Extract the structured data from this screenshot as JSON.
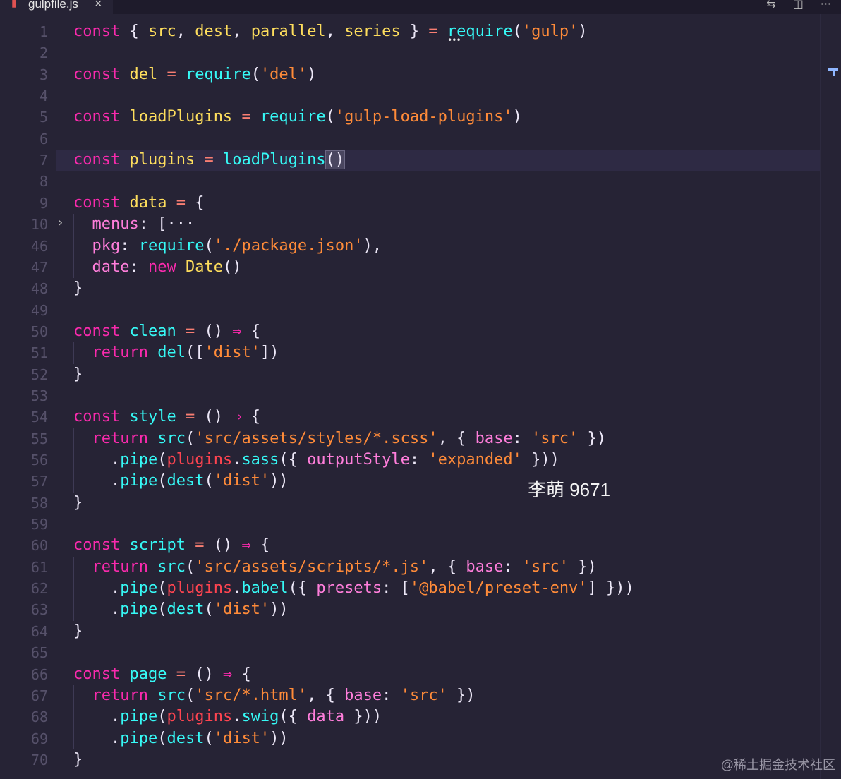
{
  "tab": {
    "filename": "gulpfile.js",
    "close": "×",
    "file_icon": "▮"
  },
  "actions": [
    "⇆",
    "◫",
    "···"
  ],
  "code": {
    "line_numbers": [
      "1",
      "2",
      "3",
      "4",
      "5",
      "6",
      "7",
      "8",
      "9",
      "10",
      "46",
      "47",
      "48",
      "49",
      "50",
      "51",
      "52",
      "53",
      "54",
      "55",
      "56",
      "57",
      "58",
      "59",
      "60",
      "61",
      "62",
      "63",
      "64",
      "65",
      "66",
      "67",
      "68",
      "69",
      "70"
    ],
    "lines": [
      [
        [
          "const ",
          "t-const"
        ],
        [
          "{ ",
          "t-pun"
        ],
        [
          "src",
          "t-name"
        ],
        [
          ", ",
          "t-pun"
        ],
        [
          "dest",
          "t-name"
        ],
        [
          ", ",
          "t-pun"
        ],
        [
          "parallel",
          "t-name"
        ],
        [
          ", ",
          "t-pun"
        ],
        [
          "series",
          "t-name"
        ],
        [
          " } ",
          "t-pun"
        ],
        [
          "= ",
          "t-op"
        ],
        [
          "require",
          "t-fn"
        ],
        [
          "(",
          "t-pun"
        ],
        [
          "'gulp'",
          "t-str"
        ],
        [
          ")",
          "t-pun"
        ]
      ],
      [],
      [
        [
          "const ",
          "t-const"
        ],
        [
          "del ",
          "t-name"
        ],
        [
          "= ",
          "t-op"
        ],
        [
          "require",
          "t-fn"
        ],
        [
          "(",
          "t-pun"
        ],
        [
          "'del'",
          "t-str"
        ],
        [
          ")",
          "t-pun"
        ]
      ],
      [],
      [
        [
          "const ",
          "t-const"
        ],
        [
          "loadPlugins ",
          "t-name"
        ],
        [
          "= ",
          "t-op"
        ],
        [
          "require",
          "t-fn"
        ],
        [
          "(",
          "t-pun"
        ],
        [
          "'gulp-load-plugins'",
          "t-str"
        ],
        [
          ")",
          "t-pun"
        ]
      ],
      [],
      [
        [
          "const ",
          "t-const"
        ],
        [
          "plugins ",
          "t-name"
        ],
        [
          "= ",
          "t-op"
        ],
        [
          "loadPlugins",
          "t-fn"
        ],
        [
          "()",
          "t-pun paren-hl"
        ]
      ],
      [],
      [
        [
          "const ",
          "t-const"
        ],
        [
          "data ",
          "t-name"
        ],
        [
          "= ",
          "t-op"
        ],
        [
          "{",
          "t-pun"
        ]
      ],
      [
        [
          "  ",
          " "
        ],
        [
          "menus",
          "t-prop"
        ],
        [
          ": ",
          "t-pun"
        ],
        [
          "[",
          "t-pun"
        ],
        [
          "···",
          "t-pun"
        ]
      ],
      [
        [
          "  ",
          " "
        ],
        [
          "pkg",
          "t-prop"
        ],
        [
          ": ",
          "t-pun"
        ],
        [
          "require",
          "t-fn"
        ],
        [
          "(",
          "t-pun"
        ],
        [
          "'./package.json'",
          "t-str"
        ],
        [
          "),",
          "t-pun"
        ]
      ],
      [
        [
          "  ",
          " "
        ],
        [
          "date",
          "t-prop"
        ],
        [
          ": ",
          "t-pun"
        ],
        [
          "new ",
          "t-const"
        ],
        [
          "Date",
          "t-new"
        ],
        [
          "()",
          "t-pun"
        ]
      ],
      [
        [
          "}",
          "t-pun"
        ]
      ],
      [],
      [
        [
          "const ",
          "t-const"
        ],
        [
          "clean ",
          "t-fn"
        ],
        [
          "= ",
          "t-op"
        ],
        [
          "() ",
          "t-pun"
        ],
        [
          "⇒ ",
          "t-const"
        ],
        [
          "{",
          "t-pun"
        ]
      ],
      [
        [
          "  ",
          " "
        ],
        [
          "return ",
          "t-const"
        ],
        [
          "del",
          "t-fn"
        ],
        [
          "([",
          "t-pun"
        ],
        [
          "'dist'",
          "t-str"
        ],
        [
          "])",
          "t-pun"
        ]
      ],
      [
        [
          "}",
          "t-pun"
        ]
      ],
      [],
      [
        [
          "const ",
          "t-const"
        ],
        [
          "style ",
          "t-fn"
        ],
        [
          "= ",
          "t-op"
        ],
        [
          "() ",
          "t-pun"
        ],
        [
          "⇒ ",
          "t-const"
        ],
        [
          "{",
          "t-pun"
        ]
      ],
      [
        [
          "  ",
          " "
        ],
        [
          "return ",
          "t-const"
        ],
        [
          "src",
          "t-fn"
        ],
        [
          "(",
          "t-pun"
        ],
        [
          "'src/assets/styles/*.scss'",
          "t-str"
        ],
        [
          ", { ",
          "t-pun"
        ],
        [
          "base",
          "t-prop"
        ],
        [
          ": ",
          "t-pun"
        ],
        [
          "'src'",
          "t-str"
        ],
        [
          " })",
          "t-pun"
        ]
      ],
      [
        [
          "    ",
          " "
        ],
        [
          ".",
          "t-pun"
        ],
        [
          "pipe",
          "t-fn"
        ],
        [
          "(",
          "t-pun"
        ],
        [
          "plugins",
          "t-cls"
        ],
        [
          ".",
          "t-pun"
        ],
        [
          "sass",
          "t-fn"
        ],
        [
          "({ ",
          "t-pun"
        ],
        [
          "outputStyle",
          "t-prop"
        ],
        [
          ": ",
          "t-pun"
        ],
        [
          "'expanded'",
          "t-str"
        ],
        [
          " }))",
          "t-pun"
        ]
      ],
      [
        [
          "    ",
          " "
        ],
        [
          ".",
          "t-pun"
        ],
        [
          "pipe",
          "t-fn"
        ],
        [
          "(",
          "t-pun"
        ],
        [
          "dest",
          "t-fn"
        ],
        [
          "(",
          "t-pun"
        ],
        [
          "'dist'",
          "t-str"
        ],
        [
          "))",
          "t-pun"
        ]
      ],
      [
        [
          "}",
          "t-pun"
        ]
      ],
      [],
      [
        [
          "const ",
          "t-const"
        ],
        [
          "script ",
          "t-fn"
        ],
        [
          "= ",
          "t-op"
        ],
        [
          "() ",
          "t-pun"
        ],
        [
          "⇒ ",
          "t-const"
        ],
        [
          "{",
          "t-pun"
        ]
      ],
      [
        [
          "  ",
          " "
        ],
        [
          "return ",
          "t-const"
        ],
        [
          "src",
          "t-fn"
        ],
        [
          "(",
          "t-pun"
        ],
        [
          "'src/assets/scripts/*.js'",
          "t-str"
        ],
        [
          ", { ",
          "t-pun"
        ],
        [
          "base",
          "t-prop"
        ],
        [
          ": ",
          "t-pun"
        ],
        [
          "'src'",
          "t-str"
        ],
        [
          " })",
          "t-pun"
        ]
      ],
      [
        [
          "    ",
          " "
        ],
        [
          ".",
          "t-pun"
        ],
        [
          "pipe",
          "t-fn"
        ],
        [
          "(",
          "t-pun"
        ],
        [
          "plugins",
          "t-cls"
        ],
        [
          ".",
          "t-pun"
        ],
        [
          "babel",
          "t-fn"
        ],
        [
          "({ ",
          "t-pun"
        ],
        [
          "presets",
          "t-prop"
        ],
        [
          ": [",
          "t-pun"
        ],
        [
          "'@babel/preset-env'",
          "t-str"
        ],
        [
          "] }))",
          "t-pun"
        ]
      ],
      [
        [
          "    ",
          " "
        ],
        [
          ".",
          "t-pun"
        ],
        [
          "pipe",
          "t-fn"
        ],
        [
          "(",
          "t-pun"
        ],
        [
          "dest",
          "t-fn"
        ],
        [
          "(",
          "t-pun"
        ],
        [
          "'dist'",
          "t-str"
        ],
        [
          "))",
          "t-pun"
        ]
      ],
      [
        [
          "}",
          "t-pun"
        ]
      ],
      [],
      [
        [
          "const ",
          "t-const"
        ],
        [
          "page ",
          "t-fn"
        ],
        [
          "= ",
          "t-op"
        ],
        [
          "() ",
          "t-pun"
        ],
        [
          "⇒ ",
          "t-const"
        ],
        [
          "{",
          "t-pun"
        ]
      ],
      [
        [
          "  ",
          " "
        ],
        [
          "return ",
          "t-const"
        ],
        [
          "src",
          "t-fn"
        ],
        [
          "(",
          "t-pun"
        ],
        [
          "'src/*.html'",
          "t-str"
        ],
        [
          ", { ",
          "t-pun"
        ],
        [
          "base",
          "t-prop"
        ],
        [
          ": ",
          "t-pun"
        ],
        [
          "'src'",
          "t-str"
        ],
        [
          " })",
          "t-pun"
        ]
      ],
      [
        [
          "    ",
          " "
        ],
        [
          ".",
          "t-pun"
        ],
        [
          "pipe",
          "t-fn"
        ],
        [
          "(",
          "t-pun"
        ],
        [
          "plugins",
          "t-cls"
        ],
        [
          ".",
          "t-pun"
        ],
        [
          "swig",
          "t-fn"
        ],
        [
          "({ ",
          "t-pun"
        ],
        [
          "data",
          "t-prop"
        ],
        [
          " }))",
          "t-pun"
        ]
      ],
      [
        [
          "    ",
          " "
        ],
        [
          ".",
          "t-pun"
        ],
        [
          "pipe",
          "t-fn"
        ],
        [
          "(",
          "t-pun"
        ],
        [
          "dest",
          "t-fn"
        ],
        [
          "(",
          "t-pun"
        ],
        [
          "'dist'",
          "t-str"
        ],
        [
          "))",
          "t-pun"
        ]
      ],
      [
        [
          "}",
          "t-pun"
        ]
      ]
    ]
  },
  "overlay_text": "李萌 9671",
  "watermark": "@稀土掘金技术社区"
}
